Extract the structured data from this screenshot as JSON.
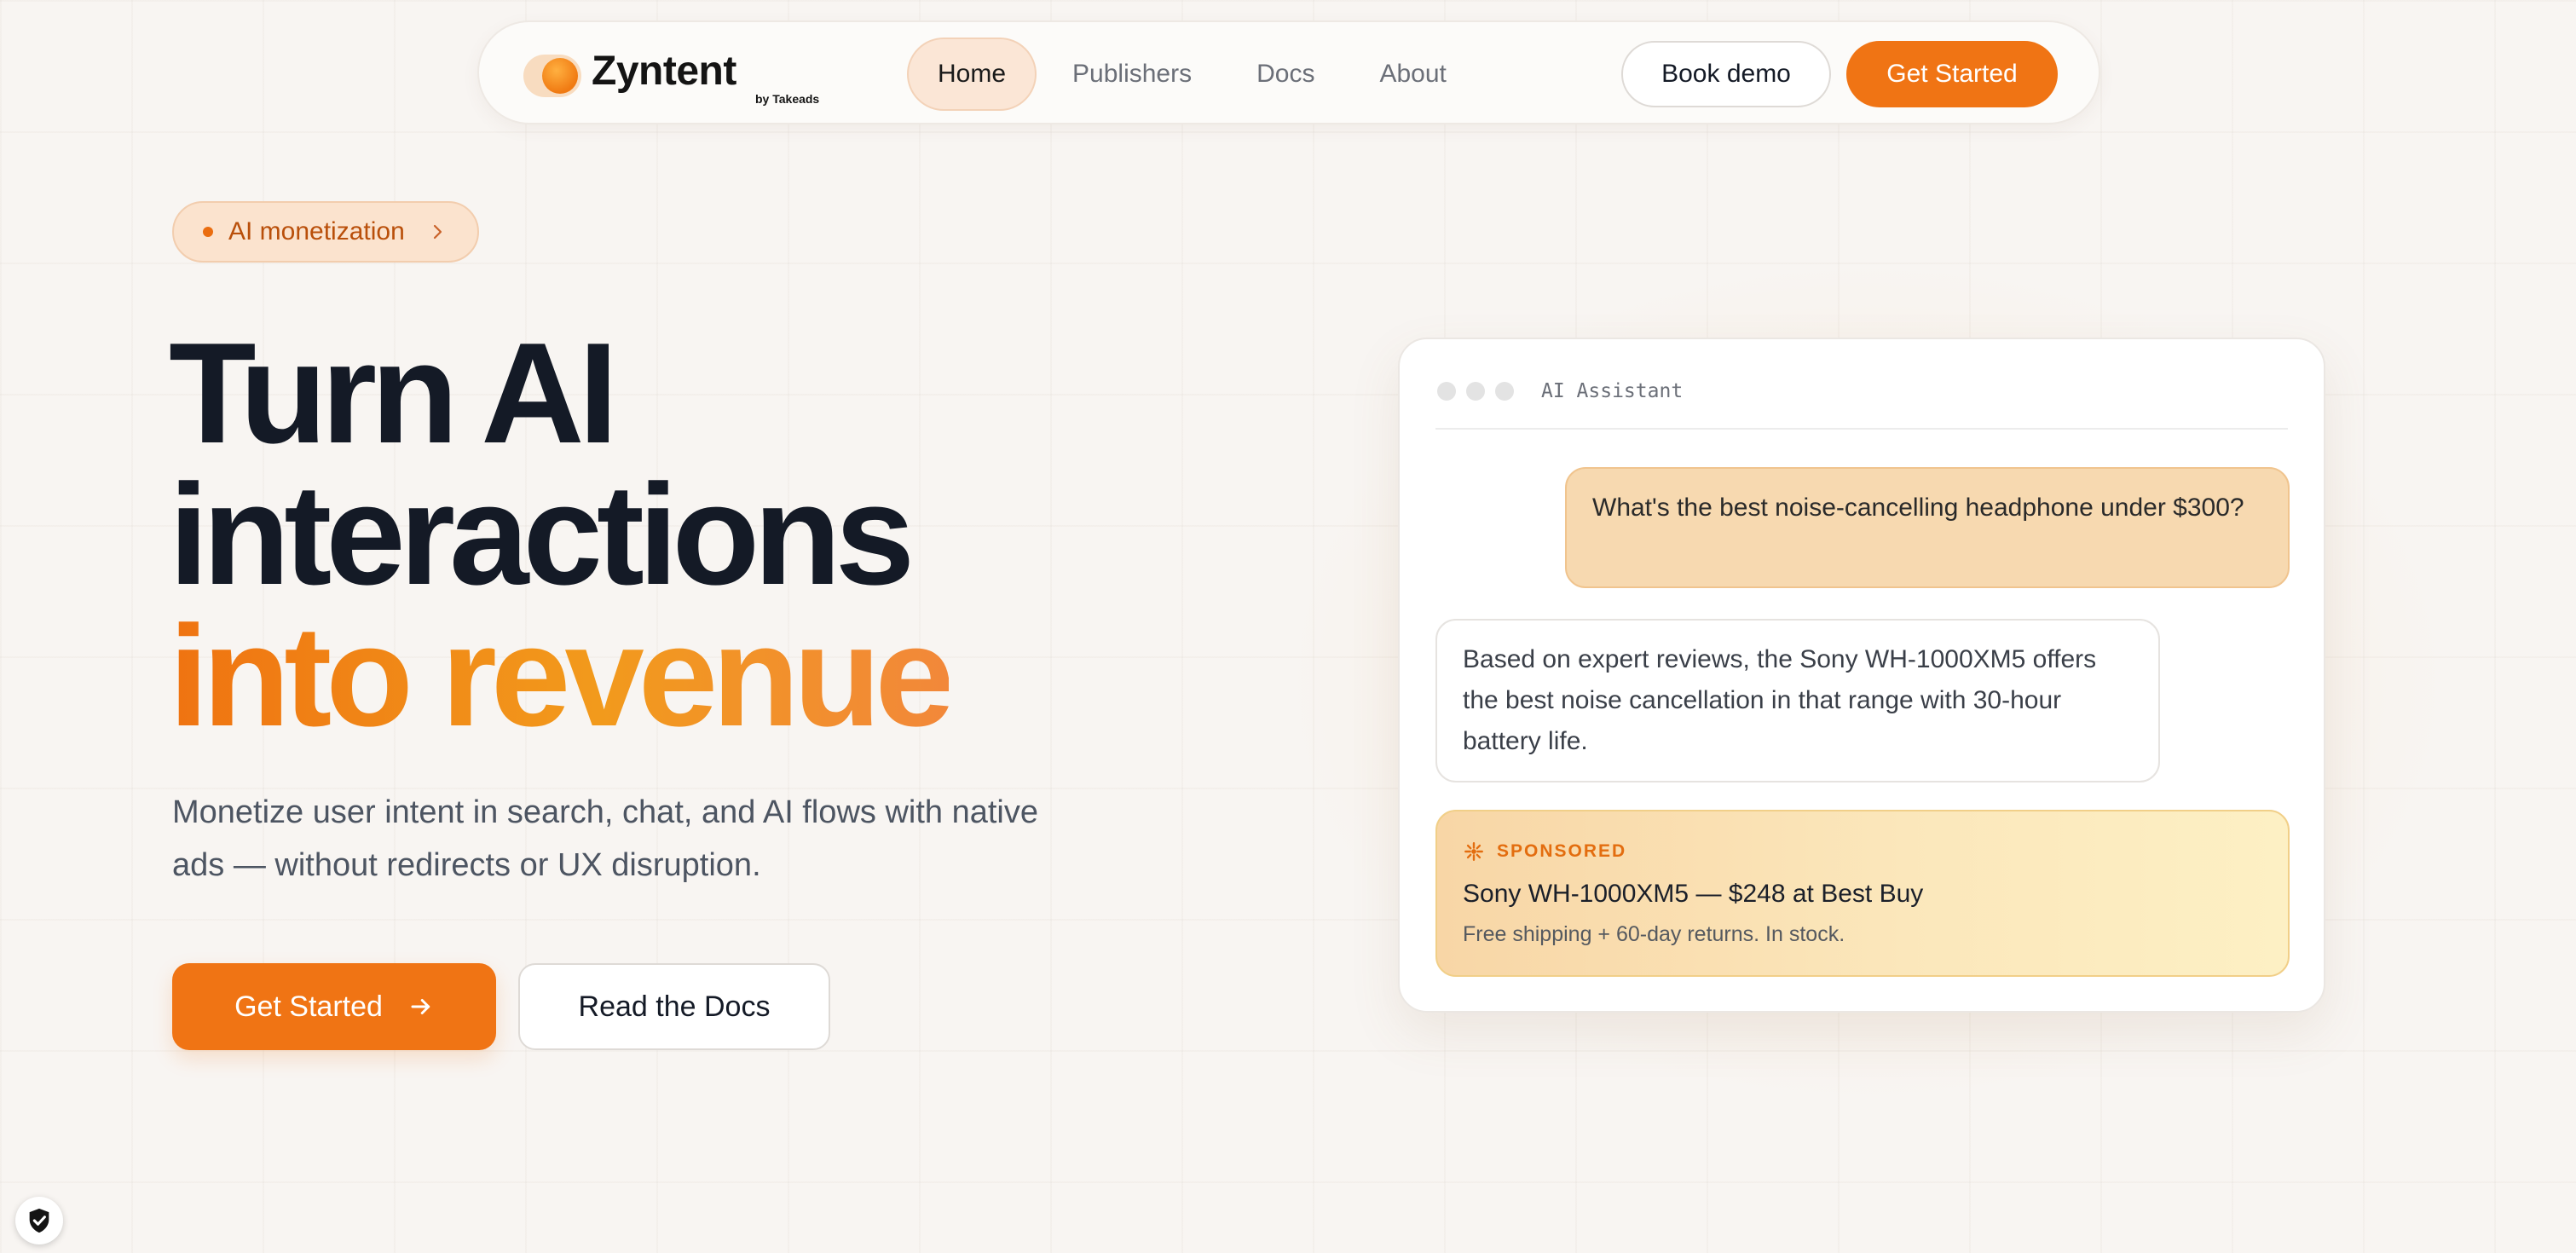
{
  "nav": {
    "logo_word": "Zyntent",
    "logo_sub": "by Takeads",
    "links": [
      {
        "label": "Home",
        "active": true
      },
      {
        "label": "Publishers",
        "active": false
      },
      {
        "label": "Docs",
        "active": false
      },
      {
        "label": "About",
        "active": false
      }
    ],
    "book_demo": "Book demo",
    "get_started": "Get Started"
  },
  "hero": {
    "pill": "AI monetization",
    "headline_line1": "Turn AI",
    "headline_line2": "interactions",
    "headline_line3": "into revenue",
    "subtext": "Monetize user intent in search, chat, and AI flows with native ads — without redirects or UX disruption.",
    "cta_primary": "Get Started",
    "cta_secondary": "Read the Docs"
  },
  "chat": {
    "title": "AI Assistant",
    "user_message": "What's the best noise-cancelling headphone under $300?",
    "ai_message": "Based on expert reviews, the Sony WH-1000XM5 offers the best noise cancellation in that range with 30-hour battery life.",
    "sponsored_label": "SPONSORED",
    "sponsored_product": "Sony WH-1000XM5 — $248 at Best Buy",
    "sponsored_desc": "Free shipping + 60-day returns. In stock."
  },
  "icons": {
    "logo": "orange-dot-logo",
    "pill_chevron": "chevron-right-icon",
    "cta_arrow": "arrow-right-icon",
    "sponsored": "sparkle-icon",
    "privacy": "shield-check-icon"
  },
  "colors": {
    "accent": "#f07414",
    "background": "#f8f5f2",
    "text": "#141a26"
  }
}
